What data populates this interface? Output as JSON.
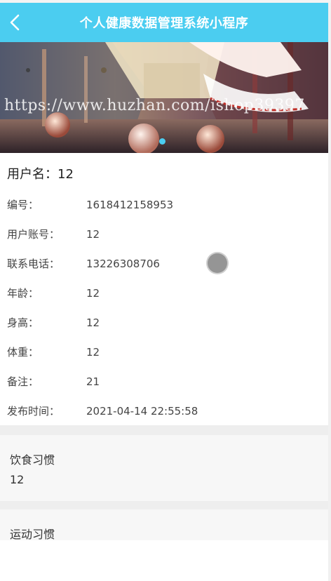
{
  "header": {
    "title": "个人健康数据管理系统小程序",
    "back_icon": "chevron-left-icon"
  },
  "banner": {
    "watermark": "https://www.huzhan.com/ishop39397",
    "indicator_color": "#4bcdf0"
  },
  "profile": {
    "username_label": "用户名：",
    "username_value": "12",
    "fields": [
      {
        "label": "编号：",
        "value": "1618412158953"
      },
      {
        "label": "用户账号：",
        "value": "12"
      },
      {
        "label": "联系电话：",
        "value": "13226308706"
      },
      {
        "label": "年龄：",
        "value": "12"
      },
      {
        "label": "身高：",
        "value": "12"
      },
      {
        "label": "体重：",
        "value": "12"
      },
      {
        "label": "备注：",
        "value": "21"
      },
      {
        "label": "发布时间：",
        "value": "2021-04-14 22:55:58"
      }
    ]
  },
  "sections": [
    {
      "title": "饮食习惯",
      "value": "12"
    },
    {
      "title": "运动习惯",
      "value": ""
    }
  ],
  "colors": {
    "navbar": "#4bcdf0",
    "text": "#444444",
    "section_bg": "#f7f7f7"
  }
}
